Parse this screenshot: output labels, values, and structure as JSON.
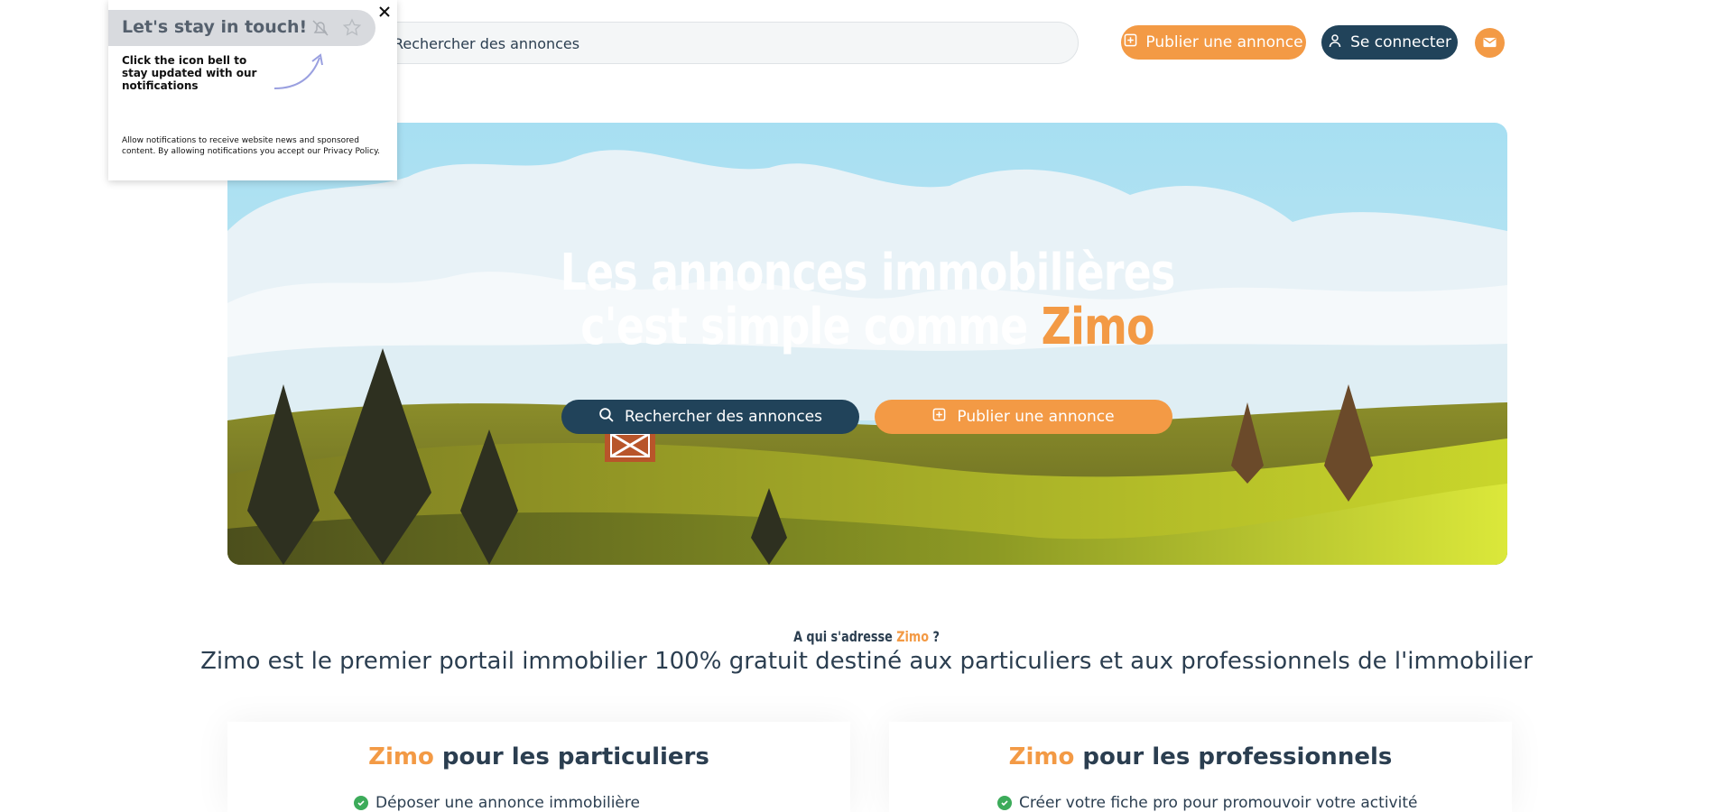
{
  "header": {
    "search_placeholder": "Rechercher des annonces",
    "publish_label": "Publier une annonce",
    "login_label": "Se connecter"
  },
  "hero": {
    "title_line1": "Les annonces immobilières",
    "title_line2_prefix": "c'est simple comme ",
    "title_brand": "Zimo",
    "search_button": "Rechercher des annonces",
    "publish_button": "Publier une annonce"
  },
  "intro": {
    "question_prefix": "A qui s'adresse ",
    "question_brand": "Zimo",
    "question_suffix": " ?",
    "text": "Zimo est le premier portail immobilier 100% gratuit destiné aux particuliers et aux professionnels de l'immobilier"
  },
  "cards": {
    "left": {
      "brand": "Zimo",
      "title": " pour les particuliers",
      "item1": "Déposer une annonce immobilière"
    },
    "right": {
      "brand": "Zimo",
      "title": " pour les professionnels",
      "item1": "Créer votre fiche pro pour promouvoir votre activité"
    }
  },
  "popup": {
    "title": "Let's stay in touch!",
    "body": "Click the icon bell to stay updated with our notifications",
    "legal": "Allow notifications to receive website news and sponsored content. By allowing notifications you accept our Privacy Policy."
  },
  "colors": {
    "brand_orange": "#f39a45",
    "navy": "#21435a",
    "check_green": "#3cab5a"
  },
  "icons": [
    "plus-square-icon",
    "user-icon",
    "mail-icon",
    "search-icon",
    "close-icon",
    "bell-off-icon",
    "star-icon",
    "arrow-icon",
    "check-icon"
  ]
}
